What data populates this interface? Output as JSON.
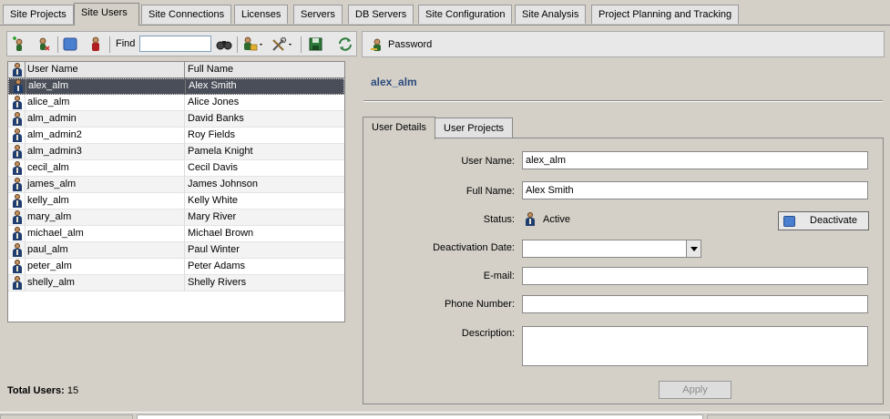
{
  "tabs": [
    {
      "label": "Site Projects",
      "active": false
    },
    {
      "label": "Site Users",
      "active": true
    },
    {
      "label": "Site Connections",
      "active": false
    },
    {
      "label": "Licenses",
      "active": false
    },
    {
      "label": "Servers",
      "active": false
    },
    {
      "label": "DB Servers",
      "active": false
    },
    {
      "label": "Site Configuration",
      "active": false
    },
    {
      "label": "Site Analysis",
      "active": false
    },
    {
      "label": "Project Planning and Tracking",
      "active": false
    }
  ],
  "toolbar": {
    "find_label": "Find",
    "find_value": "",
    "icons": [
      "add-user-icon",
      "remove-user-icon",
      "deactivate-icon",
      "user-connections-icon",
      "find-icon",
      "import-users-icon",
      "tools-icon",
      "save-icon",
      "refresh-icon"
    ]
  },
  "grid": {
    "columns": [
      "User Name",
      "Full Name"
    ],
    "rows": [
      {
        "user": "alex_alm",
        "full": "Alex Smith",
        "selected": true
      },
      {
        "user": "alice_alm",
        "full": "Alice Jones"
      },
      {
        "user": "alm_admin",
        "full": "David Banks"
      },
      {
        "user": "alm_admin2",
        "full": "Roy Fields"
      },
      {
        "user": "alm_admin3",
        "full": "Pamela Knight"
      },
      {
        "user": "cecil_alm",
        "full": "Cecil Davis"
      },
      {
        "user": "james_alm",
        "full": "James Johnson"
      },
      {
        "user": "kelly_alm",
        "full": "Kelly White"
      },
      {
        "user": "mary_alm",
        "full": "Mary River"
      },
      {
        "user": "michael_alm",
        "full": "Michael Brown"
      },
      {
        "user": "paul_alm",
        "full": "Paul Winter"
      },
      {
        "user": "peter_alm",
        "full": "Peter Adams"
      },
      {
        "user": "shelly_alm",
        "full": "Shelly Rivers"
      }
    ]
  },
  "total": {
    "label": "Total Users:",
    "value": "15"
  },
  "right": {
    "password_label": "Password",
    "selected_user": "alex_alm",
    "tabs": [
      "User Details",
      "User Projects"
    ],
    "details": {
      "user_name_label": "User Name:",
      "user_name": "alex_alm",
      "full_name_label": "Full Name:",
      "full_name": "Alex Smith",
      "status_label": "Status:",
      "status": "Active",
      "deactivate_label": "Deactivate",
      "deactivation_date_label": "Deactivation Date:",
      "deactivation_date": "",
      "email_label": "E-mail:",
      "email": "",
      "phone_label": "Phone Number:",
      "phone": "",
      "description_label": "Description:",
      "description": "",
      "apply_label": "Apply"
    }
  },
  "colors": {
    "accent_title": "#2b4b7b",
    "selection": "#4a4e58",
    "background": "#d4d0c8"
  }
}
